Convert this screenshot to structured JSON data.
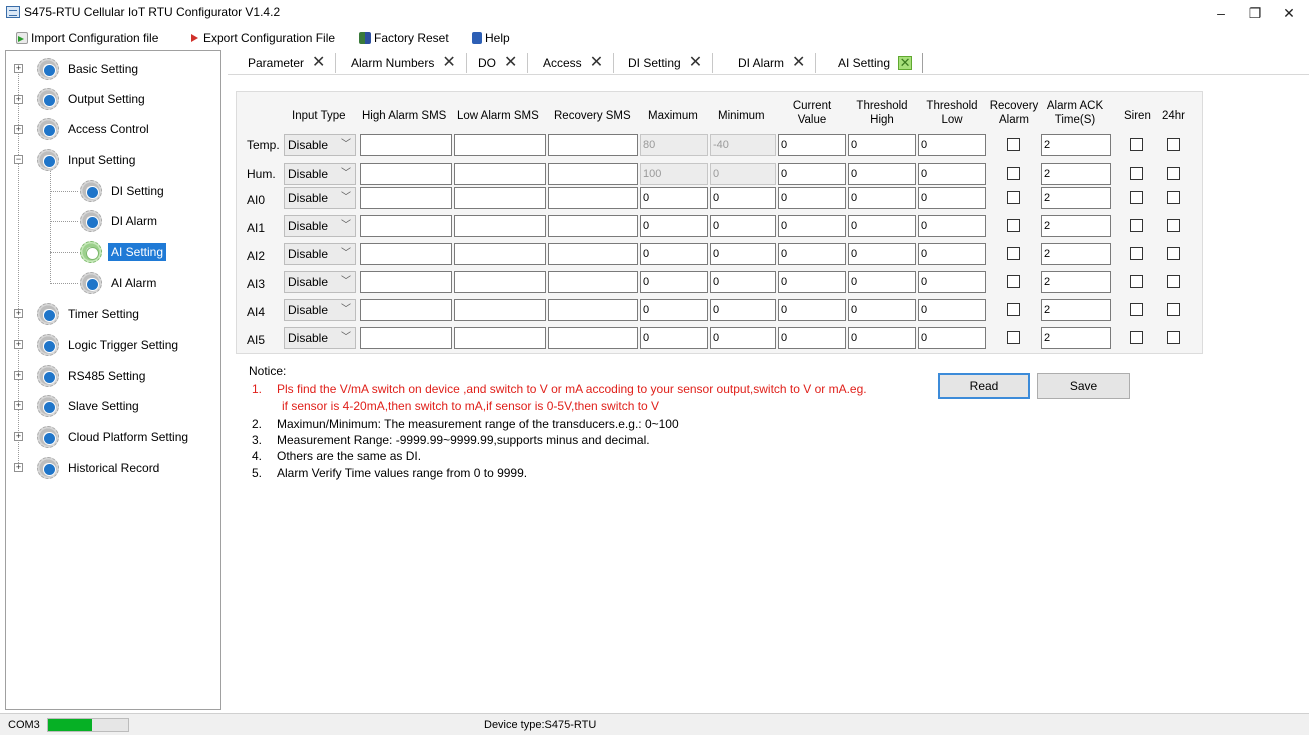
{
  "window": {
    "title": "S475-RTU Cellular IoT RTU Configurator V1.4.2",
    "minimize": "–",
    "restore": "❐",
    "close": "✕"
  },
  "menu": {
    "import": "Import Configuration file",
    "export": "Export Configuration File",
    "factory_reset": "Factory Reset",
    "help": "Help"
  },
  "tree": {
    "basic": "Basic Setting",
    "output": "Output Setting",
    "access": "Access Control",
    "input": "Input Setting",
    "di_setting": "DI Setting",
    "di_alarm": "DI Alarm",
    "ai_setting": "AI Setting",
    "ai_alarm": "AI Alarm",
    "timer": "Timer Setting",
    "logic": "Logic Trigger Setting",
    "rs485": "RS485 Setting",
    "slave": "Slave Setting",
    "cloud": "Cloud Platform Setting",
    "historical": "Historical Record"
  },
  "tabs": [
    "Parameter",
    "Alarm Numbers",
    "DO",
    "Access",
    "DI Setting",
    "DI Alarm",
    "AI Setting"
  ],
  "tab_close": "✕",
  "table": {
    "headers": {
      "input_type": "Input Type",
      "high_sms": "High Alarm SMS",
      "low_sms": "Low Alarm SMS",
      "recovery_sms": "Recovery SMS",
      "maximum": "Maximum",
      "minimum": "Minimum",
      "current_1": "Current",
      "current_2": "Value",
      "th_high_1": "Threshold",
      "th_high_2": "High",
      "th_low_1": "Threshold",
      "th_low_2": "Low",
      "recovery_1": "Recovery",
      "recovery_2": "Alarm",
      "ack_1": "Alarm ACK",
      "ack_2": "Time(S)",
      "siren": "Siren",
      "hr24": "24hr"
    },
    "rows": [
      {
        "label": "Temp.",
        "type": "Disable",
        "max": "80",
        "min": "-40",
        "current": "0",
        "th_high": "0",
        "th_low": "0",
        "ack": "2"
      },
      {
        "label": "Hum.",
        "type": "Disable",
        "max": "100",
        "min": "0",
        "current": "0",
        "th_high": "0",
        "th_low": "0",
        "ack": "2"
      },
      {
        "label": "AI0",
        "type": "Disable",
        "max": "0",
        "min": "0",
        "current": "0",
        "th_high": "0",
        "th_low": "0",
        "ack": "2"
      },
      {
        "label": "AI1",
        "type": "Disable",
        "max": "0",
        "min": "0",
        "current": "0",
        "th_high": "0",
        "th_low": "0",
        "ack": "2"
      },
      {
        "label": "AI2",
        "type": "Disable",
        "max": "0",
        "min": "0",
        "current": "0",
        "th_high": "0",
        "th_low": "0",
        "ack": "2"
      },
      {
        "label": "AI3",
        "type": "Disable",
        "max": "0",
        "min": "0",
        "current": "0",
        "th_high": "0",
        "th_low": "0",
        "ack": "2"
      },
      {
        "label": "AI4",
        "type": "Disable",
        "max": "0",
        "min": "0",
        "current": "0",
        "th_high": "0",
        "th_low": "0",
        "ack": "2"
      },
      {
        "label": "AI5",
        "type": "Disable",
        "max": "0",
        "min": "0",
        "current": "0",
        "th_high": "0",
        "th_low": "0",
        "ack": "2"
      }
    ]
  },
  "notice": {
    "title": "Notice:",
    "n1_num": "1.",
    "n1_line1": "Pls find the V/mA switch on device ,and switch to V or mA accoding to your sensor output,switch to V or mA.eg.",
    "n1_line2": "if sensor is 4-20mA,then switch to mA,if sensor is 0-5V,then switch to V",
    "n2_num": "2.",
    "n2": "Maximun/Minimum: The measurement range of the transducers.e.g.: 0~100",
    "n3_num": "3.",
    "n3": "Measurement Range: -9999.99~9999.99,supports minus and decimal.",
    "n4_num": "4.",
    "n4": "Others are the same as DI.",
    "n5_num": "5.",
    "n5": "Alarm Verify Time values range from 0 to 9999."
  },
  "buttons": {
    "read": "Read",
    "save": "Save"
  },
  "status": {
    "port": "COM3",
    "progress_fraction": 0.55,
    "device": "Device type:S475-RTU"
  },
  "colors": {
    "selection": "#1f7ad6",
    "notice_red": "#e0201a",
    "progress_green": "#06b025"
  }
}
